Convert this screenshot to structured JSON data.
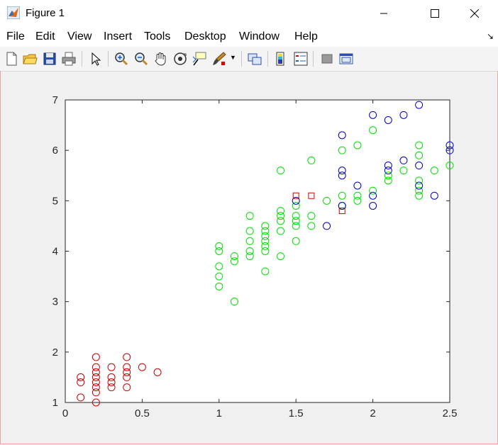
{
  "window": {
    "title": "Figure 1",
    "icons": [
      "matlab-figure-icon",
      "minimize-icon",
      "maximize-icon",
      "close-icon"
    ]
  },
  "menu": {
    "items": [
      "File",
      "Edit",
      "View",
      "Insert",
      "Tools",
      "Desktop",
      "Window",
      "Help"
    ]
  },
  "toolbar": {
    "icons": [
      "new-figure-icon",
      "open-file-icon",
      "save-icon",
      "print-icon",
      "edit-plot-icon",
      "zoom-in-icon",
      "zoom-out-icon",
      "pan-icon",
      "rotate-3d-icon",
      "data-cursor-icon",
      "brush-icon",
      "link-plot-icon",
      "colorbar-icon",
      "legend-icon",
      "hide-plot-tools-icon",
      "show-plot-tools-icon"
    ]
  },
  "chart_data": {
    "type": "scatter",
    "xlim": [
      0,
      2.5
    ],
    "ylim": [
      1,
      7
    ],
    "xticks": [
      "0",
      "0.5",
      "1",
      "1.5",
      "2",
      "2.5"
    ],
    "yticks": [
      "1",
      "2",
      "3",
      "4",
      "5",
      "6",
      "7"
    ],
    "grid": false,
    "legend": "none",
    "series": [
      {
        "color": "#cc0000",
        "marker": "circle",
        "points": [
          [
            0.1,
            1.5
          ],
          [
            0.1,
            1.4
          ],
          [
            0.1,
            1.1
          ],
          [
            0.2,
            1.9
          ],
          [
            0.2,
            1.7
          ],
          [
            0.2,
            1.6
          ],
          [
            0.2,
            1.5
          ],
          [
            0.2,
            1.4
          ],
          [
            0.2,
            1.3
          ],
          [
            0.2,
            1.2
          ],
          [
            0.2,
            1.0
          ],
          [
            0.3,
            1.7
          ],
          [
            0.3,
            1.5
          ],
          [
            0.3,
            1.4
          ],
          [
            0.3,
            1.3
          ],
          [
            0.4,
            1.9
          ],
          [
            0.4,
            1.7
          ],
          [
            0.4,
            1.6
          ],
          [
            0.4,
            1.5
          ],
          [
            0.4,
            1.3
          ],
          [
            0.5,
            1.7
          ],
          [
            0.6,
            1.6
          ]
        ]
      },
      {
        "color": "#00e000",
        "marker": "circle",
        "points": [
          [
            1.0,
            4.1
          ],
          [
            1.0,
            4.0
          ],
          [
            1.0,
            3.7
          ],
          [
            1.0,
            3.5
          ],
          [
            1.0,
            3.3
          ],
          [
            1.1,
            3.9
          ],
          [
            1.1,
            3.8
          ],
          [
            1.1,
            3.0
          ],
          [
            1.2,
            4.7
          ],
          [
            1.2,
            4.4
          ],
          [
            1.2,
            4.2
          ],
          [
            1.2,
            4.0
          ],
          [
            1.2,
            3.9
          ],
          [
            1.3,
            4.5
          ],
          [
            1.3,
            4.4
          ],
          [
            1.3,
            4.3
          ],
          [
            1.3,
            4.2
          ],
          [
            1.3,
            4.1
          ],
          [
            1.3,
            4.0
          ],
          [
            1.3,
            3.6
          ],
          [
            1.4,
            5.6
          ],
          [
            1.4,
            4.8
          ],
          [
            1.4,
            4.7
          ],
          [
            1.4,
            4.6
          ],
          [
            1.4,
            4.4
          ],
          [
            1.4,
            3.9
          ],
          [
            1.5,
            4.9
          ],
          [
            1.5,
            4.7
          ],
          [
            1.5,
            4.6
          ],
          [
            1.5,
            4.5
          ],
          [
            1.5,
            4.2
          ],
          [
            1.6,
            5.8
          ],
          [
            1.6,
            4.7
          ],
          [
            1.6,
            4.5
          ],
          [
            1.7,
            5.0
          ],
          [
            1.8,
            6.0
          ],
          [
            1.8,
            5.1
          ],
          [
            1.8,
            4.9
          ],
          [
            1.9,
            6.1
          ],
          [
            1.9,
            5.1
          ],
          [
            1.9,
            5.0
          ],
          [
            2.0,
            6.4
          ],
          [
            2.0,
            5.2
          ],
          [
            2.1,
            5.5
          ],
          [
            2.1,
            5.4
          ],
          [
            2.2,
            5.6
          ],
          [
            2.3,
            6.1
          ],
          [
            2.3,
            5.9
          ],
          [
            2.3,
            5.4
          ],
          [
            2.3,
            5.2
          ],
          [
            2.3,
            5.1
          ],
          [
            2.4,
            5.6
          ],
          [
            2.5,
            5.7
          ]
        ]
      },
      {
        "color": "#0000cc",
        "marker": "circle",
        "points": [
          [
            1.5,
            5.0
          ],
          [
            1.7,
            4.5
          ],
          [
            1.8,
            6.3
          ],
          [
            1.8,
            5.6
          ],
          [
            1.8,
            5.5
          ],
          [
            1.8,
            4.9
          ],
          [
            1.9,
            5.3
          ],
          [
            2.0,
            6.7
          ],
          [
            2.0,
            5.1
          ],
          [
            2.0,
            4.9
          ],
          [
            2.1,
            6.6
          ],
          [
            2.1,
            5.7
          ],
          [
            2.1,
            5.6
          ],
          [
            2.2,
            6.7
          ],
          [
            2.2,
            5.8
          ],
          [
            2.3,
            6.9
          ],
          [
            2.3,
            5.7
          ],
          [
            2.3,
            5.3
          ],
          [
            2.4,
            5.1
          ],
          [
            2.5,
            6.1
          ],
          [
            2.5,
            6.0
          ]
        ]
      },
      {
        "color": "#cc0000",
        "marker": "square",
        "points": [
          [
            1.5,
            5.1
          ],
          [
            1.6,
            5.1
          ],
          [
            1.8,
            4.8
          ]
        ]
      }
    ]
  }
}
